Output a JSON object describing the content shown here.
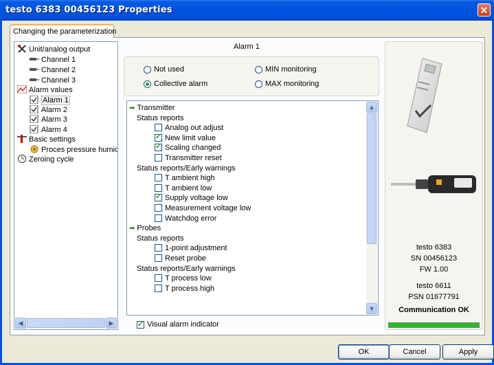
{
  "window": {
    "title": "testo 6383  00456123 Properties",
    "close_symbol": "✕"
  },
  "tab": {
    "label": "Changing the parameterization"
  },
  "tree": [
    {
      "label": "Unit/analog output",
      "icon": "tools-icon"
    },
    {
      "label": "Channel 1",
      "icon": "channel-icon"
    },
    {
      "label": "Channel 2",
      "icon": "channel-icon"
    },
    {
      "label": "Channel 3",
      "icon": "channel-icon"
    },
    {
      "label": "Alarm values",
      "icon": "alarm-chart-icon"
    },
    {
      "label": "Alarm 1",
      "icon": "checkbox-doc-icon",
      "selected": true
    },
    {
      "label": "Alarm 2",
      "icon": "checkbox-doc-icon"
    },
    {
      "label": "Alarm 3",
      "icon": "checkbox-doc-icon"
    },
    {
      "label": "Alarm 4",
      "icon": "checkbox-doc-icon"
    },
    {
      "label": "Basic settings",
      "icon": "settings-icon"
    },
    {
      "label": "Proces pressure humidity",
      "icon": "process-icon"
    },
    {
      "label": "Zeroing cycle",
      "icon": "clock-icon"
    }
  ],
  "alarm": {
    "title": "Alarm 1",
    "modes": [
      {
        "label": "Not used",
        "checked": false
      },
      {
        "label": "MIN monitoring",
        "checked": false
      },
      {
        "label": "Collective alarm",
        "checked": true
      },
      {
        "label": "MAX monitoring",
        "checked": false
      }
    ]
  },
  "events": [
    {
      "type": "group",
      "label": "Transmitter"
    },
    {
      "type": "sub",
      "label": "Status reports"
    },
    {
      "type": "item",
      "label": "Analog out adjust",
      "checked": false
    },
    {
      "type": "item",
      "label": "New limit value",
      "checked": true
    },
    {
      "type": "item",
      "label": "Scaling changed",
      "checked": true
    },
    {
      "type": "item",
      "label": "Transmitter reset",
      "checked": false
    },
    {
      "type": "sub",
      "label": "Status reports/Early warnings"
    },
    {
      "type": "item",
      "label": "T ambient high",
      "checked": false
    },
    {
      "type": "item",
      "label": "T ambient low",
      "checked": false
    },
    {
      "type": "item",
      "label": "Supply voltage low",
      "checked": true
    },
    {
      "type": "item",
      "label": "Measurement voltage low",
      "checked": false
    },
    {
      "type": "item",
      "label": "Watchdog error",
      "checked": false
    },
    {
      "type": "group",
      "label": "Probes"
    },
    {
      "type": "sub",
      "label": "Status reports"
    },
    {
      "type": "item",
      "label": "1-point adjustment",
      "checked": false
    },
    {
      "type": "item",
      "label": "Reset probe",
      "checked": false
    },
    {
      "type": "sub",
      "label": "Status reports/Early warnings"
    },
    {
      "type": "item",
      "label": "T process low",
      "checked": false
    },
    {
      "type": "item",
      "label": "T process high",
      "checked": false
    }
  ],
  "visual_alarm": {
    "label": "Visual alarm indicator",
    "checked": true
  },
  "device": {
    "model": "testo 6383",
    "serial": "SN 00456123",
    "firmware": "FW 1.00",
    "probe_model": "testo 6611",
    "probe_serial": "PSN 01677791",
    "status": "Communication OK",
    "connection_level": 1.0
  },
  "buttons": {
    "ok": "OK",
    "cancel": "Cancel",
    "apply": "Apply"
  },
  "colors": {
    "titlebar": "#0054e3",
    "accent_green": "#21c021",
    "tab_highlight": "#f8b648"
  }
}
